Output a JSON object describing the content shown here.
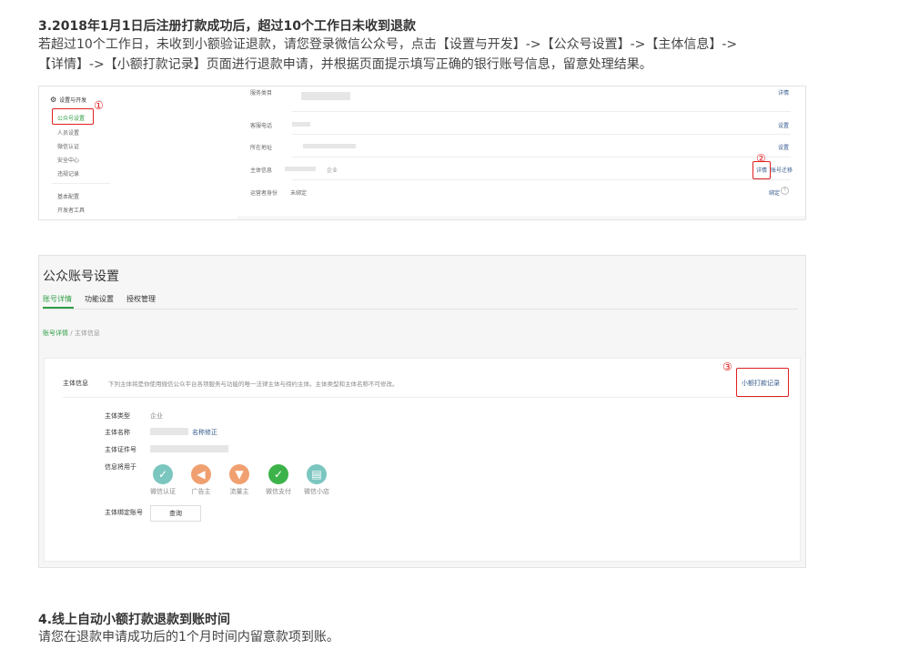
{
  "section3": {
    "title": "3.2018年1月1日后注册打款成功后，超过10个工作日未收到退款",
    "body_line1": "若超过10个工作日，未收到小额验证退款，请您登录微信公众号，点击【设置与开发】->【公众号设置】->【主体信息】->",
    "body_line2": "【详情】->【小额打款记录】页面进行退款申请，并根据页面提示填写正确的银行账号信息，留意处理结果。"
  },
  "shot1": {
    "sidebar": {
      "group": "设置与开发",
      "items": [
        "公众号设置",
        "人员设置",
        "微信认证",
        "安全中心",
        "违规记录"
      ],
      "items2": [
        "基本配置",
        "开发者工具"
      ]
    },
    "rows": [
      {
        "label": "服务类目",
        "action": "详情"
      },
      {
        "label": "客服电话",
        "action": "设置"
      },
      {
        "label": "所在地址",
        "action": "设置"
      },
      {
        "label": "主体信息",
        "suffix": "企业",
        "action": "详情",
        "action2": "账号迁移"
      },
      {
        "label": "运营者身份",
        "value": "未绑定",
        "action": "绑定"
      }
    ],
    "markers": [
      "①",
      "②"
    ]
  },
  "shot2": {
    "title": "公众账号设置",
    "tabs": [
      "账号详情",
      "功能设置",
      "授权管理"
    ],
    "breadcrumb_active": "账号详情",
    "breadcrumb_sep": "/",
    "breadcrumb_current": "主体信息",
    "section_label": "主体信息",
    "section_desc": "下列主体将是你使用微信公众平台各项服务与功能的唯一法律主体与缔约主体。主体类型和主体名称不可修改。",
    "record_link": "小额打款记录",
    "marker": "③",
    "fields": {
      "type_label": "主体类型",
      "type_value": "企业",
      "name_label": "主体名称",
      "name_action": "名称修正",
      "cert_label": "主体证件号",
      "usage_label": "信息将用于",
      "bind_label": "主体绑定账号",
      "bind_button": "查询"
    },
    "usage_icons": [
      {
        "icon": "check-icon",
        "label": "微信认证",
        "color": "#7cc6c0"
      },
      {
        "icon": "megaphone-icon",
        "label": "广告主",
        "color": "#f0a070"
      },
      {
        "icon": "funnel-icon",
        "label": "流量主",
        "color": "#f0a070"
      },
      {
        "icon": "wechat-pay-icon",
        "label": "微信支付",
        "color": "#3cb34a"
      },
      {
        "icon": "shop-icon",
        "label": "微信小店",
        "color": "#7cc6c0"
      }
    ]
  },
  "section4": {
    "title": "4.线上自动小额打款退款到账时间",
    "body": "请您在退款申请成功后的1个月时间内留意款项到账。"
  }
}
